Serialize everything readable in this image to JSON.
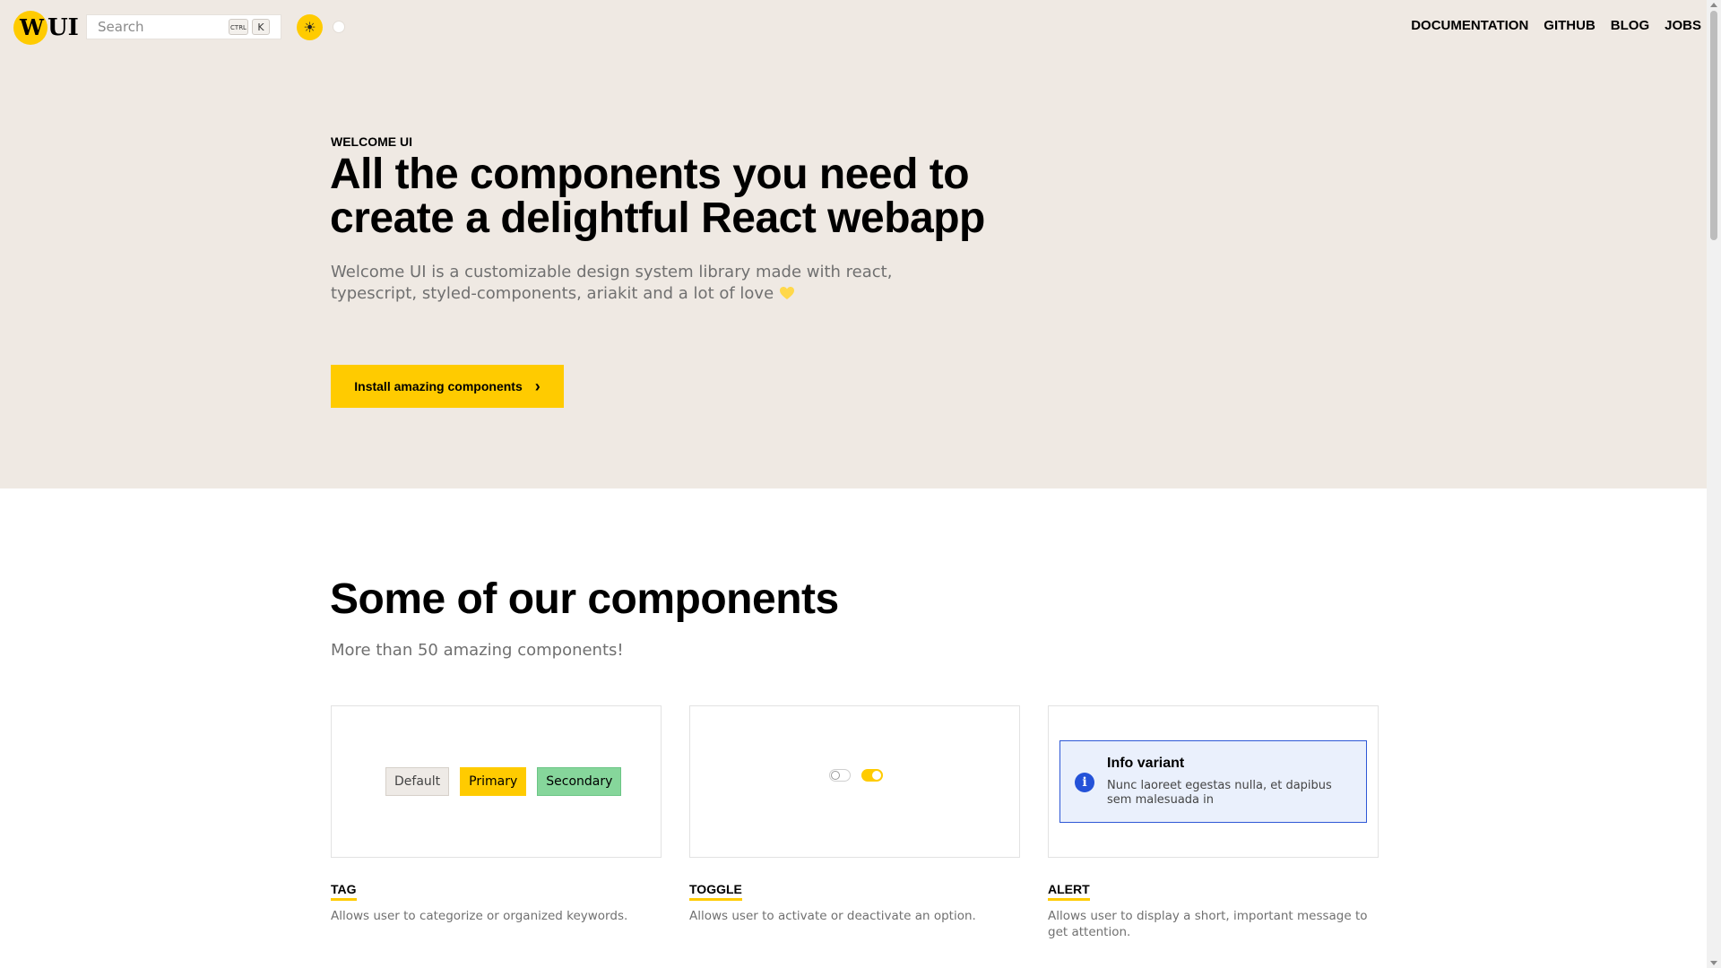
{
  "header": {
    "logo_mark": "W",
    "logo_text": "UI",
    "search": {
      "placeholder": "Search",
      "shortcut_modifier": "CTRL",
      "shortcut_key": "K"
    },
    "nav": [
      "DOCUMENTATION",
      "GITHUB",
      "BLOG",
      "JOBS"
    ]
  },
  "hero": {
    "eyebrow": "WELCOME UI",
    "title": "All the components you need to create a delightful React webapp",
    "description": "Welcome UI is a customizable design system library made with react, typescript, styled-components, ariakit and a lot of love",
    "cta_label": "Install amazing components",
    "background": "#efe9e3",
    "accent": "#ffcb00"
  },
  "components": {
    "title": "Some of our components",
    "subtitle": "More than 50 amazing components!",
    "tag_demo": {
      "labels": [
        "Default",
        "Primary",
        "Secondary"
      ]
    },
    "toggle_demo": {
      "states": [
        false,
        true
      ]
    },
    "alert_demo": {
      "title": "Info variant",
      "text": "Nunc laoreet egestas nulla, et dapibus sem malesuada in",
      "color": "#2452d8"
    },
    "items": [
      {
        "name": "TAG",
        "description": "Allows user to categorize or organized keywords."
      },
      {
        "name": "TOGGLE",
        "description": "Allows user to activate or deactivate an option."
      },
      {
        "name": "ALERT",
        "description": "Allows user to display a short, important message to get attention."
      }
    ]
  }
}
